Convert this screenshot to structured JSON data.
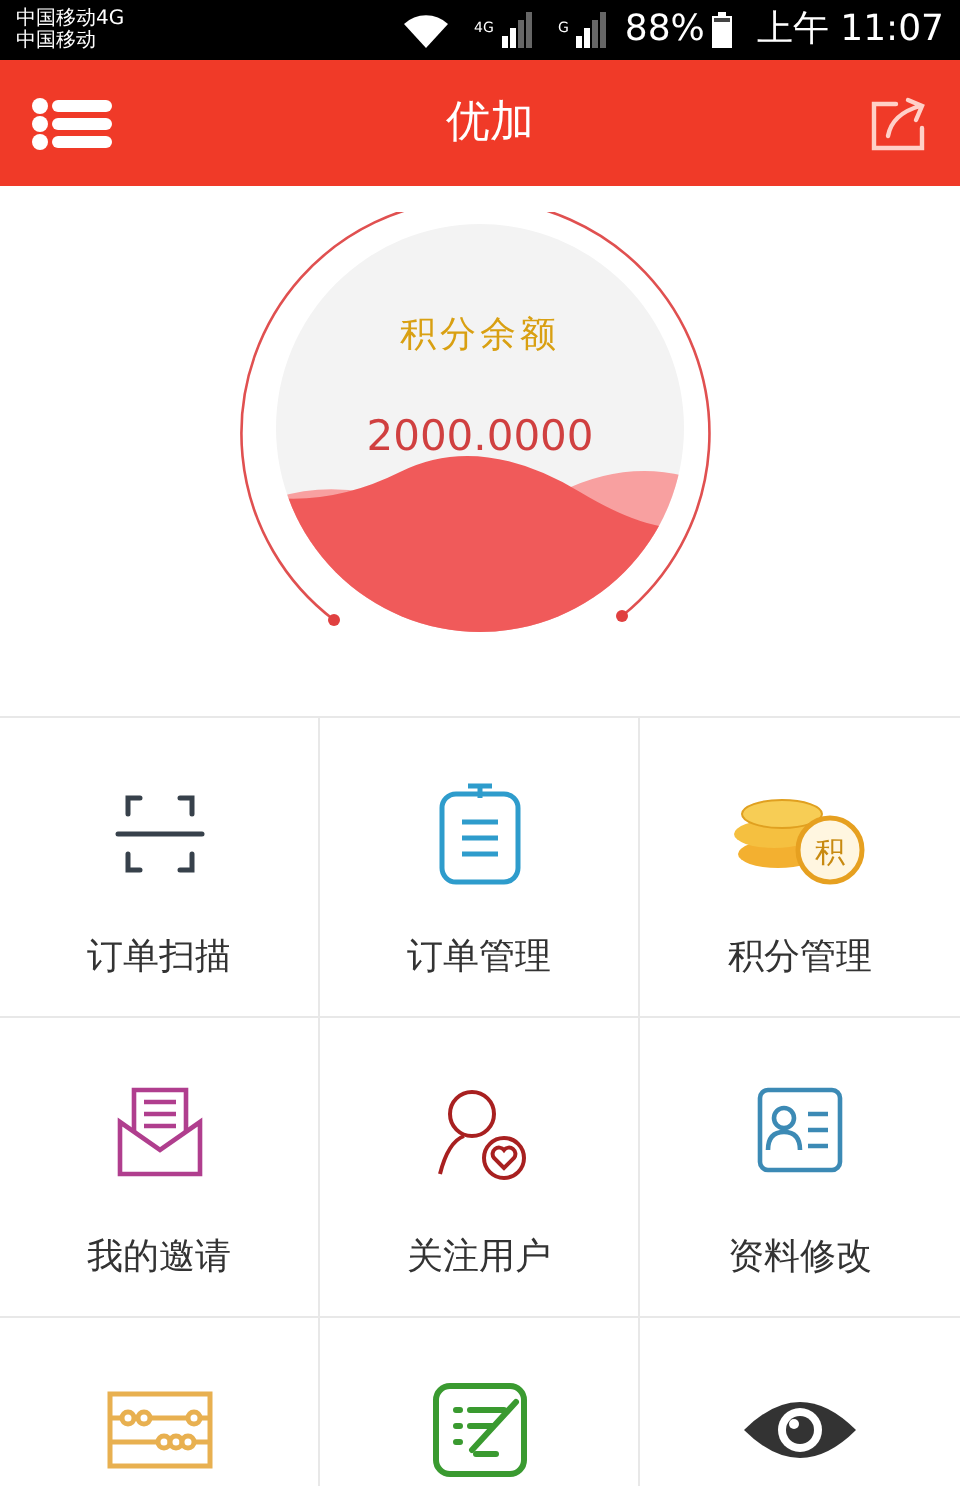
{
  "status_bar": {
    "carriers": [
      "中国移动4G",
      "中国移动"
    ],
    "network_labels": [
      "4G",
      "G"
    ],
    "battery": "88%",
    "time": "上午 11:07"
  },
  "header": {
    "title": "优加"
  },
  "balance": {
    "label": "积分余额",
    "value": "2000.0000"
  },
  "menu": [
    {
      "kind": "labeled",
      "label": "订单扫描"
    },
    {
      "kind": "labeled",
      "label": "订单管理"
    },
    {
      "kind": "labeled",
      "icon_text": "积",
      "label": "积分管理"
    },
    {
      "kind": "labeled",
      "label": "我的邀请"
    },
    {
      "kind": "labeled",
      "label": "关注用户"
    },
    {
      "kind": "labeled",
      "label": "资料修改"
    },
    {
      "kind": "icon-only"
    },
    {
      "kind": "icon-only"
    },
    {
      "kind": "icon-only"
    }
  ]
}
